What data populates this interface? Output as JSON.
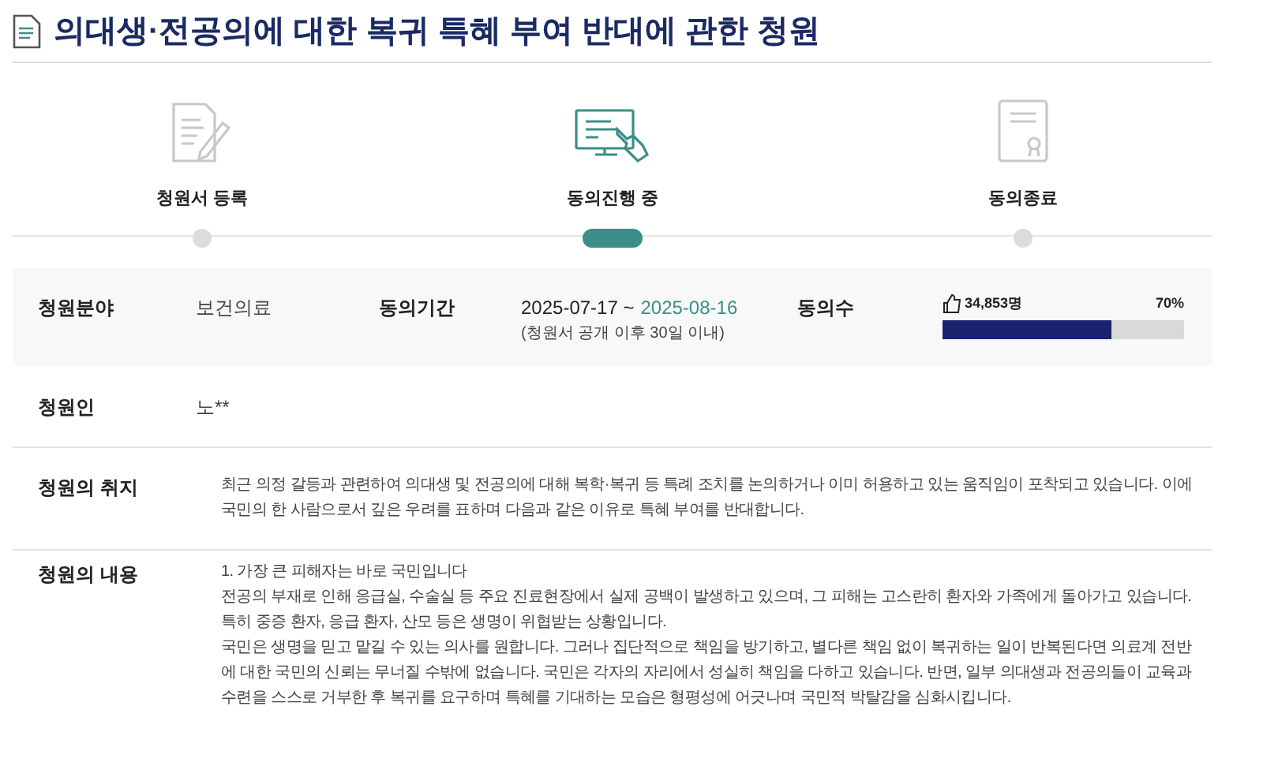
{
  "title": "의대생·전공의에 대한 복귀 특혜 부여 반대에 관한 청원",
  "steps": [
    {
      "label": "청원서 등록",
      "kind": "write",
      "selected": false
    },
    {
      "label": "동의진행 중",
      "kind": "screen",
      "selected": true
    },
    {
      "label": "동의종료",
      "kind": "certificate",
      "selected": false
    }
  ],
  "info": {
    "field_label": "청원분야",
    "field_value": "보건의료",
    "period_label": "동의기간",
    "period_start": "2025-07-17 ~",
    "period_end": "2025-08-16",
    "period_note": "(청원서 공개 이후 30일 이내)",
    "consent_label": "동의수",
    "consent_count": "34,853명",
    "consent_percent": "70%",
    "level": 0.7
  },
  "petitioner": {
    "label": "청원인",
    "value": "노**"
  },
  "purpose": {
    "label": "청원의 취지",
    "text": "최근 의정 갈등과 관련하여 의대생 및 전공의에 대해 복학·복귀 등 특례 조치를 논의하거나 이미 허용하고 있는 움직임이 포착되고 있습니다. 이에 국민의 한 사람으로서 깊은 우려를 표하며 다음과 같은 이유로 특혜 부여를 반대합니다."
  },
  "content": {
    "label": "청원의 내용",
    "paragraphs": [
      "1. 가장 큰 피해자는 바로 국민입니다",
      "전공의 부재로 인해 응급실, 수술실 등 주요 진료현장에서 실제 공백이 발생하고 있으며, 그 피해는 고스란히 환자와 가족에게 돌아가고 있습니다. 특히 중증 환자, 응급 환자, 산모 등은 생명이 위협받는 상황입니다.",
      "국민은 생명을 믿고 맡길 수 있는 의사를 원합니다. 그러나 집단적으로 책임을 방기하고, 별다른 책임 없이 복귀하는 일이 반복된다면 의료계 전반에 대한 국민의 신뢰는 무너질 수밖에 없습니다. 국민은 각자의 자리에서 성실히 책임을 다하고 있습니다. 반면, 일부 의대생과 전공의들이 교육과 수련을 스스로 거부한 후 복귀를 요구하며 특혜를 기대하는 모습은 형평성에 어긋나며 국민적 박탈감을 심화시킵니다."
    ]
  }
}
